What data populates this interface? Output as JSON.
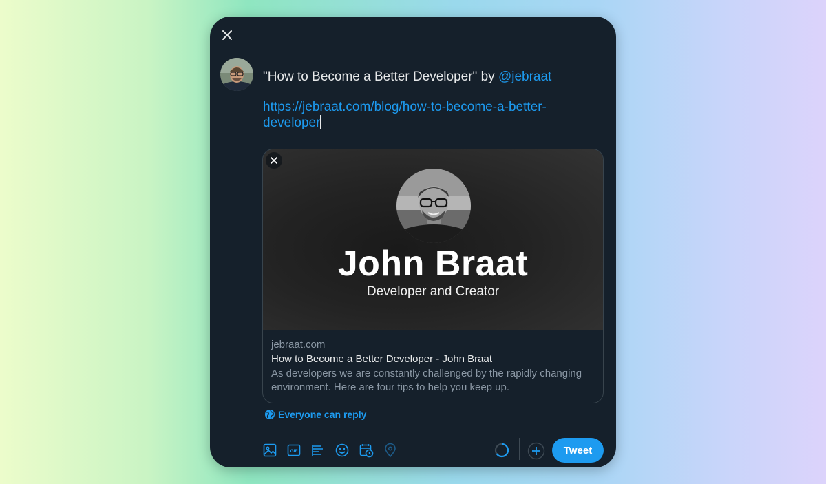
{
  "compose": {
    "title_prefix": "\"How to Become a Better Developer\" by ",
    "mention": "@jebraat",
    "url_line1": "https://jebraat.com/blog/how-to-become-a-better-",
    "url_line2": "developer"
  },
  "card": {
    "name": "John Braat",
    "tagline": "Developer and Creator",
    "domain": "jebraat.com",
    "title": "How to Become a Better Developer - John Braat",
    "description": "As developers we are constantly challenged by the rapidly changing environment. Here are four tips to help you keep up."
  },
  "reply_setting": {
    "label": "Everyone can reply",
    "icon": "globe-icon"
  },
  "toolbar": {
    "icons": [
      "media-icon",
      "gif-icon",
      "poll-icon",
      "emoji-icon",
      "schedule-icon",
      "location-icon"
    ],
    "tweet_label": "Tweet"
  },
  "colors": {
    "accent": "#1d9bf0",
    "background": "#15202b",
    "border": "#38444d",
    "muted_text": "#8b98a5"
  }
}
